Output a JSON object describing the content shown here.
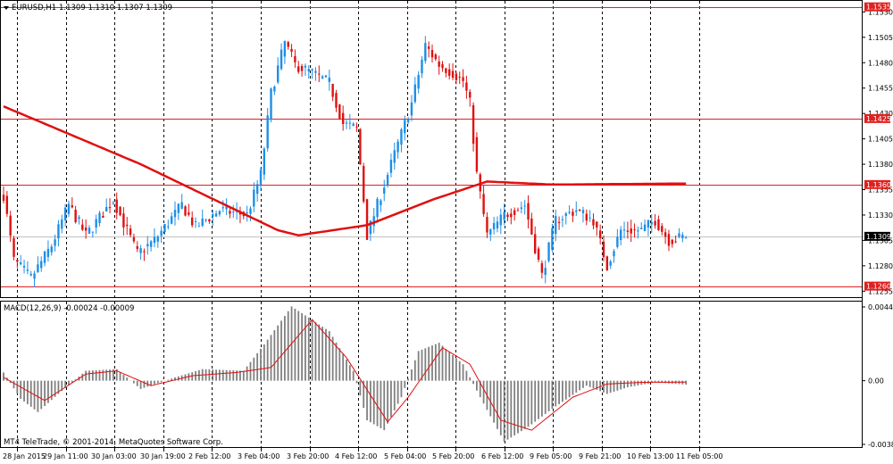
{
  "header": {
    "symbol_label": "EURUSD,H1",
    "ohlc_label": "1.1309 1.1310 1.1307 1.1309",
    "macd_label": "MACD(12,26,9) -0.00024 -0.00009",
    "copyright": "MT4 TeleTrade, © 2001-2014, MetaQuotes Software Corp."
  },
  "colors": {
    "bull": "#1e8fe6",
    "bear": "#e01010",
    "level_line": "#e02020",
    "ma_line": "#e01010",
    "macd_hist": "#808080",
    "signal_line": "#e01010",
    "grid": "#000000",
    "price_tag_bg": "#e02020",
    "current_tag_bg": "#000000"
  },
  "price_axis": {
    "ticks": [
      "1.1530",
      "1.1505",
      "1.1480",
      "1.1455",
      "1.1430",
      "1.1405",
      "1.1380",
      "1.1355",
      "1.1330",
      "1.1305",
      "1.1280",
      "1.1255"
    ],
    "tags": [
      {
        "label": "1.1535",
        "price": 1.1535,
        "kind": "level"
      },
      {
        "label": "1.1425",
        "price": 1.1425,
        "kind": "level"
      },
      {
        "label": "1.1360",
        "price": 1.136,
        "kind": "level"
      },
      {
        "label": "1.1309",
        "price": 1.1309,
        "kind": "current"
      },
      {
        "label": "1.1260",
        "price": 1.126,
        "kind": "level"
      }
    ]
  },
  "macd_axis": {
    "ticks": [
      {
        "label": "0.00447",
        "value": 0.00447
      },
      {
        "label": "0.00",
        "value": 0.0
      },
      {
        "label": "-0.00386",
        "value": -0.00386
      }
    ]
  },
  "time_axis": {
    "labels": [
      "28 Jan 2015",
      "29 Jan 11:00",
      "30 Jan 03:00",
      "30 Jan 19:00",
      "2 Feb 12:00",
      "3 Feb 04:00",
      "3 Feb 20:00",
      "4 Feb 12:00",
      "5 Feb 04:00",
      "5 Feb 20:00",
      "6 Feb 12:00",
      "9 Feb 05:00",
      "9 Feb 21:00",
      "10 Feb 13:00",
      "11 Feb 05:00"
    ]
  },
  "chart_data": [
    {
      "type": "candlestick",
      "title": "EURUSD,H1",
      "bars": 200,
      "ylim": [
        1.125,
        1.154
      ],
      "horizontal_levels": [
        1.1535,
        1.1425,
        1.136,
        1.126
      ],
      "current_price": 1.1309,
      "keypoints": [
        {
          "i": 0,
          "p": 1.135
        },
        {
          "i": 3,
          "p": 1.1285
        },
        {
          "i": 8,
          "p": 1.1268
        },
        {
          "i": 14,
          "p": 1.13
        },
        {
          "i": 19,
          "p": 1.134
        },
        {
          "i": 24,
          "p": 1.131
        },
        {
          "i": 32,
          "p": 1.1345
        },
        {
          "i": 39,
          "p": 1.1292
        },
        {
          "i": 44,
          "p": 1.1305
        },
        {
          "i": 52,
          "p": 1.134
        },
        {
          "i": 56,
          "p": 1.1318
        },
        {
          "i": 63,
          "p": 1.1335
        },
        {
          "i": 71,
          "p": 1.133
        },
        {
          "i": 75,
          "p": 1.137
        },
        {
          "i": 78,
          "p": 1.145
        },
        {
          "i": 82,
          "p": 1.15
        },
        {
          "i": 85,
          "p": 1.1478
        },
        {
          "i": 90,
          "p": 1.147
        },
        {
          "i": 95,
          "p": 1.146
        },
        {
          "i": 99,
          "p": 1.142
        },
        {
          "i": 103,
          "p": 1.1415
        },
        {
          "i": 106,
          "p": 1.131
        },
        {
          "i": 110,
          "p": 1.135
        },
        {
          "i": 114,
          "p": 1.139
        },
        {
          "i": 119,
          "p": 1.144
        },
        {
          "i": 123,
          "p": 1.1497
        },
        {
          "i": 127,
          "p": 1.1478
        },
        {
          "i": 131,
          "p": 1.147
        },
        {
          "i": 134,
          "p": 1.1462
        },
        {
          "i": 136,
          "p": 1.144
        },
        {
          "i": 138,
          "p": 1.137
        },
        {
          "i": 141,
          "p": 1.131
        },
        {
          "i": 146,
          "p": 1.133
        },
        {
          "i": 152,
          "p": 1.134
        },
        {
          "i": 157,
          "p": 1.127
        },
        {
          "i": 161,
          "p": 1.1325
        },
        {
          "i": 167,
          "p": 1.1335
        },
        {
          "i": 172,
          "p": 1.1325
        },
        {
          "i": 176,
          "p": 1.128
        },
        {
          "i": 180,
          "p": 1.1315
        },
        {
          "i": 186,
          "p": 1.1315
        },
        {
          "i": 190,
          "p": 1.1325
        },
        {
          "i": 194,
          "p": 1.1305
        },
        {
          "i": 199,
          "p": 1.1309
        }
      ],
      "moving_average": [
        {
          "i": 0,
          "p": 1.1437
        },
        {
          "i": 40,
          "p": 1.138
        },
        {
          "i": 80,
          "p": 1.1315
        },
        {
          "i": 86,
          "p": 1.131
        },
        {
          "i": 106,
          "p": 1.132
        },
        {
          "i": 125,
          "p": 1.1345
        },
        {
          "i": 141,
          "p": 1.1363
        },
        {
          "i": 160,
          "p": 1.136
        },
        {
          "i": 199,
          "p": 1.1361
        }
      ]
    },
    {
      "type": "bar",
      "title": "MACD(12,26,9) -0.00024 -0.00009",
      "ylim": [
        -0.00386,
        0.00447
      ],
      "histogram_keypoints": [
        {
          "i": 0,
          "v": 0.0005
        },
        {
          "i": 5,
          "v": -0.0011
        },
        {
          "i": 10,
          "v": -0.0019
        },
        {
          "i": 16,
          "v": -0.0008
        },
        {
          "i": 24,
          "v": 0.0006
        },
        {
          "i": 33,
          "v": 0.0007
        },
        {
          "i": 40,
          "v": -0.0005
        },
        {
          "i": 50,
          "v": 0.0002
        },
        {
          "i": 58,
          "v": 0.0007
        },
        {
          "i": 70,
          "v": 0.0006
        },
        {
          "i": 76,
          "v": 0.0022
        },
        {
          "i": 84,
          "v": 0.0045
        },
        {
          "i": 95,
          "v": 0.003
        },
        {
          "i": 102,
          "v": 0.0006
        },
        {
          "i": 106,
          "v": -0.0024
        },
        {
          "i": 111,
          "v": -0.003
        },
        {
          "i": 116,
          "v": -0.001
        },
        {
          "i": 121,
          "v": 0.0018
        },
        {
          "i": 127,
          "v": 0.0023
        },
        {
          "i": 134,
          "v": 0.001
        },
        {
          "i": 139,
          "v": -0.001
        },
        {
          "i": 146,
          "v": -0.0037
        },
        {
          "i": 153,
          "v": -0.0028
        },
        {
          "i": 160,
          "v": -0.0017
        },
        {
          "i": 170,
          "v": -0.0003
        },
        {
          "i": 176,
          "v": -0.0008
        },
        {
          "i": 182,
          "v": -0.0004
        },
        {
          "i": 190,
          "v": -0.0001
        },
        {
          "i": 199,
          "v": -0.00024
        }
      ],
      "signal_keypoints": [
        {
          "i": 0,
          "v": 0.0002
        },
        {
          "i": 12,
          "v": -0.0012
        },
        {
          "i": 24,
          "v": 0.0004
        },
        {
          "i": 33,
          "v": 0.0006
        },
        {
          "i": 43,
          "v": -0.0003
        },
        {
          "i": 55,
          "v": 0.0003
        },
        {
          "i": 68,
          "v": 0.0005
        },
        {
          "i": 78,
          "v": 0.0008
        },
        {
          "i": 90,
          "v": 0.0037
        },
        {
          "i": 100,
          "v": 0.0014
        },
        {
          "i": 112,
          "v": -0.0025
        },
        {
          "i": 118,
          "v": -0.001
        },
        {
          "i": 128,
          "v": 0.002
        },
        {
          "i": 136,
          "v": 0.001
        },
        {
          "i": 145,
          "v": -0.0024
        },
        {
          "i": 154,
          "v": -0.003
        },
        {
          "i": 166,
          "v": -0.001
        },
        {
          "i": 176,
          "v": -0.0002
        },
        {
          "i": 186,
          "v": -0.0001
        },
        {
          "i": 199,
          "v": -9e-05
        }
      ]
    }
  ]
}
